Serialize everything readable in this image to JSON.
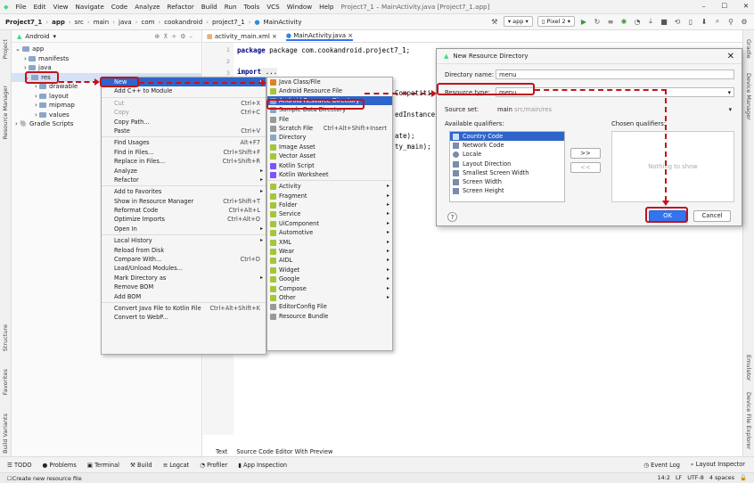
{
  "menubar": {
    "items": [
      "File",
      "Edit",
      "View",
      "Navigate",
      "Code",
      "Analyze",
      "Refactor",
      "Build",
      "Run",
      "Tools",
      "VCS",
      "Window",
      "Help"
    ],
    "title": "Project7_1 – MainActivity.java [Project7_1.app]"
  },
  "navbar": {
    "crumbs": [
      "Project7_1",
      "app",
      "src",
      "main",
      "java",
      "com",
      "cookandroid",
      "project7_1",
      "MainActivity"
    ],
    "config": "app",
    "device": "Pixel 2"
  },
  "left_strip": {
    "tabs": [
      "Project",
      "Resource Manager",
      "Structure",
      "Favorites",
      "Build Variants"
    ]
  },
  "right_strip": {
    "tabs": [
      "Gradle",
      "Device Manager",
      "Emulator",
      "Device File Explorer"
    ]
  },
  "project_panel": {
    "view": "Android",
    "tree": [
      {
        "label": "app",
        "indent": 0
      },
      {
        "label": "manifests",
        "indent": 1
      },
      {
        "label": "java",
        "indent": 1
      },
      {
        "label": "res",
        "indent": 1
      },
      {
        "label": "drawable",
        "indent": 2
      },
      {
        "label": "layout",
        "indent": 2
      },
      {
        "label": "mipmap",
        "indent": 2
      },
      {
        "label": "values",
        "indent": 2
      },
      {
        "label": "Gradle Scripts",
        "indent": 0
      }
    ]
  },
  "editor": {
    "tabs": [
      "activity_main.xml",
      "MainActivity.java"
    ],
    "line_numbers": [
      "1",
      "2",
      "3"
    ],
    "line1": "package com.cookandroid.project7_1;",
    "line3_kw": "import",
    "line3_rest": " ...",
    "frag1": "edInstances",
    "frag2": "ate);",
    "frag3": "ty_main);",
    "frag4": "Compatiti",
    "bottom_tabs": [
      "Text",
      "Source Code Editor With Preview"
    ]
  },
  "context_menu": {
    "items": [
      {
        "label": "New",
        "shortcut": "",
        "sel": true,
        "arrow": true
      },
      {
        "label": "Add C++ to Module",
        "shortcut": ""
      },
      {
        "sep": true
      },
      {
        "label": "Cut",
        "shortcut": "Ctrl+X",
        "dim": true
      },
      {
        "label": "Copy",
        "shortcut": "Ctrl+C",
        "dim": true
      },
      {
        "label": "Copy Path...",
        "shortcut": ""
      },
      {
        "label": "Paste",
        "shortcut": "Ctrl+V"
      },
      {
        "sep": true
      },
      {
        "label": "Find Usages",
        "shortcut": "Alt+F7"
      },
      {
        "label": "Find in Files...",
        "shortcut": "Ctrl+Shift+F"
      },
      {
        "label": "Replace in Files...",
        "shortcut": "Ctrl+Shift+R"
      },
      {
        "label": "Analyze",
        "shortcut": "",
        "arrow": true
      },
      {
        "label": "Refactor",
        "shortcut": "",
        "arrow": true
      },
      {
        "sep": true
      },
      {
        "label": "Add to Favorites",
        "shortcut": "",
        "arrow": true
      },
      {
        "label": "Show in Resource Manager",
        "shortcut": "Ctrl+Shift+T"
      },
      {
        "label": "Reformat Code",
        "shortcut": "Ctrl+Alt+L"
      },
      {
        "label": "Optimize Imports",
        "shortcut": "Ctrl+Alt+O"
      },
      {
        "label": "Open In",
        "shortcut": "",
        "arrow": true
      },
      {
        "sep": true
      },
      {
        "label": "Local History",
        "shortcut": "",
        "arrow": true
      },
      {
        "label": "Reload from Disk",
        "shortcut": ""
      },
      {
        "label": "Compare With...",
        "shortcut": "Ctrl+D"
      },
      {
        "label": "Load/Unload Modules...",
        "shortcut": ""
      },
      {
        "label": "Mark Directory as",
        "shortcut": "",
        "arrow": true
      },
      {
        "label": "Remove BOM",
        "shortcut": ""
      },
      {
        "label": "Add BOM",
        "shortcut": ""
      },
      {
        "sep": true
      },
      {
        "label": "Convert Java File to Kotlin File",
        "shortcut": "Ctrl+Alt+Shift+K"
      },
      {
        "label": "Convert to WebP...",
        "shortcut": ""
      }
    ]
  },
  "submenu": {
    "items": [
      {
        "label": "Java Class/File",
        "color": "#d9822b"
      },
      {
        "label": "Android Resource File",
        "color": "#a4c639"
      },
      {
        "label": "Android Resource Directory",
        "color": "#8aa7c8",
        "sel": true
      },
      {
        "label": "Sample Data Directory",
        "color": "#8aa7c8"
      },
      {
        "label": "File",
        "color": "#999999"
      },
      {
        "label": "Scratch File",
        "color": "#999999",
        "shortcut": "Ctrl+Alt+Shift+Insert"
      },
      {
        "label": "Directory",
        "color": "#8aa7c8"
      },
      {
        "label": "Image Asset",
        "color": "#a4c639"
      },
      {
        "label": "Vector Asset",
        "color": "#a4c639"
      },
      {
        "label": "Kotlin Script",
        "color": "#7f52ff"
      },
      {
        "label": "Kotlin Worksheet",
        "color": "#7f52ff"
      },
      {
        "sep": true
      },
      {
        "label": "Activity",
        "color": "#a4c639",
        "arrow": true
      },
      {
        "label": "Fragment",
        "color": "#a4c639",
        "arrow": true
      },
      {
        "label": "Folder",
        "color": "#a4c639",
        "arrow": true
      },
      {
        "label": "Service",
        "color": "#a4c639",
        "arrow": true
      },
      {
        "label": "UiComponent",
        "color": "#a4c639",
        "arrow": true
      },
      {
        "label": "Automotive",
        "color": "#a4c639",
        "arrow": true
      },
      {
        "label": "XML",
        "color": "#a4c639",
        "arrow": true
      },
      {
        "label": "Wear",
        "color": "#a4c639",
        "arrow": true
      },
      {
        "label": "AIDL",
        "color": "#a4c639",
        "arrow": true
      },
      {
        "label": "Widget",
        "color": "#a4c639",
        "arrow": true
      },
      {
        "label": "Google",
        "color": "#a4c639",
        "arrow": true
      },
      {
        "label": "Compose",
        "color": "#a4c639",
        "arrow": true
      },
      {
        "label": "Other",
        "color": "#a4c639",
        "arrow": true
      },
      {
        "label": "EditorConfig File",
        "color": "#999999"
      },
      {
        "label": "Resource Bundle",
        "color": "#999999"
      }
    ]
  },
  "dialog": {
    "title": "New Resource Directory",
    "dir_label": "Directory name:",
    "dir_value": "menu",
    "type_label": "Resource type:",
    "type_value": "menu",
    "source_label": "Source set:",
    "source_value": "main",
    "source_hint": "src/main/res",
    "available_label": "Available qualifiers:",
    "chosen_label": "Chosen qualifiers:",
    "qualifiers": [
      "Country Code",
      "Network Code",
      "Locale",
      "Layout Direction",
      "Smallest Screen Width",
      "Screen Width",
      "Screen Height"
    ],
    "nothing": "Nothing to show",
    "add_btn": ">>",
    "remove_btn": "<<",
    "ok": "OK",
    "cancel": "Cancel",
    "help": "?"
  },
  "toolstrip": {
    "items": [
      "TODO",
      "Problems",
      "Terminal",
      "Build",
      "Logcat",
      "Profiler",
      "App Inspection"
    ],
    "right": [
      "Event Log",
      "Layout Inspector"
    ]
  },
  "status": {
    "text": "Create new resource file",
    "right": [
      "14:2",
      "LF",
      "UTF-8",
      "4 spaces"
    ]
  },
  "accent": {
    "red": "#c0141c",
    "selection": "#2f65ca"
  }
}
